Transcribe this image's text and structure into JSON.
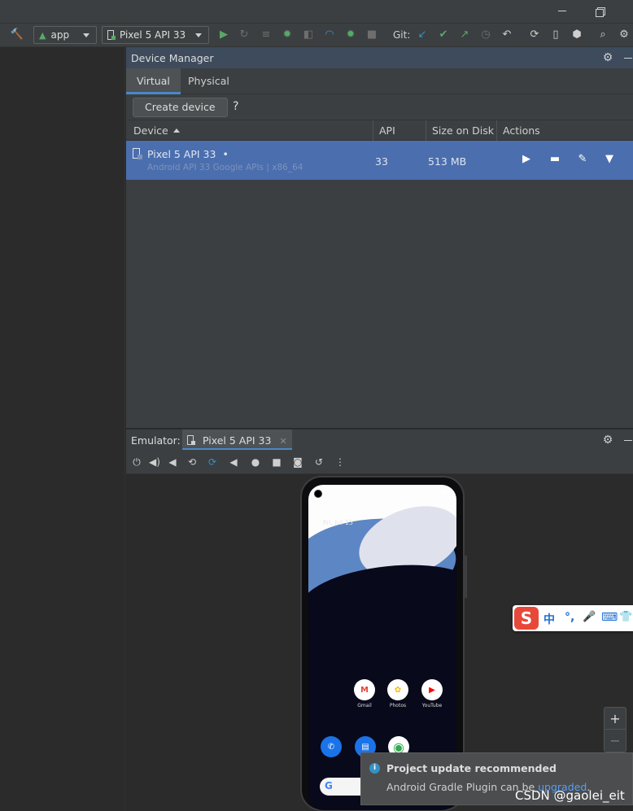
{
  "toolbar": {
    "run_config": "app",
    "device_selector": "Pixel 5 API 33",
    "git_label": "Git:"
  },
  "device_manager": {
    "title": "Device Manager",
    "tabs": [
      "Virtual",
      "Physical"
    ],
    "create_button": "Create device",
    "help": "?",
    "columns": [
      "Device",
      "API",
      "Size on Disk",
      "Actions"
    ],
    "rows": [
      {
        "name": "Pixel 5 API 33",
        "status_dot": "•",
        "subtitle": "Android API 33 Google APIs | x86_64",
        "api": "33",
        "size": "513 MB"
      }
    ]
  },
  "emulator": {
    "label": "Emulator:",
    "tab": "Pixel 5 API 33",
    "phone": {
      "date": "Fri, Jul 15",
      "apps": [
        {
          "label": "Gmail",
          "glyph": "M",
          "color": "#ea4335"
        },
        {
          "label": "Photos",
          "glyph": "✿",
          "color": "#fbbc05"
        },
        {
          "label": "YouTube",
          "glyph": "▶",
          "color": "#ff0000"
        },
        {
          "label": "",
          "glyph": "✆",
          "color": "#1a73e8"
        },
        {
          "label": "",
          "glyph": "▤",
          "color": "#1a73e8"
        },
        {
          "label": "",
          "glyph": "◉",
          "color": "#34a853"
        }
      ],
      "search_glyph": "G"
    }
  },
  "ime": {
    "logo": "S",
    "mode": "中",
    "punct": "°,",
    "mic": "🎤",
    "kbd": "⌨",
    "skin": "👕"
  },
  "zoom": {
    "plus": "+",
    "minus": "−"
  },
  "notification": {
    "title": "Project update recommended",
    "text_prefix": "Android Gradle Plugin can be ",
    "link": "upgraded",
    "text_suffix": "."
  },
  "watermark": "CSDN @gaolei_eit",
  "colors": {
    "selection": "#4b6eaf",
    "accent": "#4a88c7",
    "green": "#59a869"
  }
}
